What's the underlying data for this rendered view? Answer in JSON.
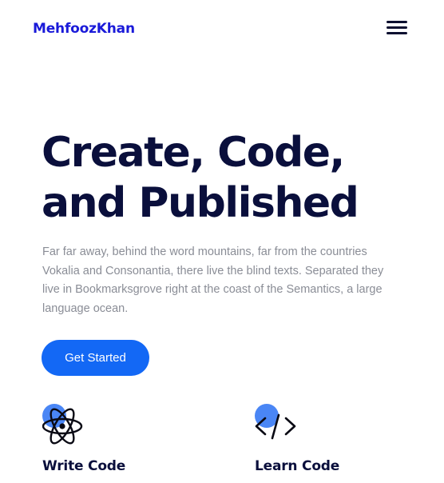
{
  "header": {
    "brand": "MehfoozKhan",
    "menu_icon": "hamburger-menu-icon"
  },
  "hero": {
    "title_line_1": "Create, Code,",
    "title_line_2": "and Published",
    "description": "Far far away, behind the word mountains, far from the countries Vokalia and Consonantia, there live the blind texts. Separated they live in Bookmarksgrove right at the coast of the Semantics, a large language ocean.",
    "cta_label": "Get Started"
  },
  "features": [
    {
      "icon": "atom-icon",
      "title": "Write Code"
    },
    {
      "icon": "code-brackets-icon",
      "title": "Learn Code"
    }
  ],
  "colors": {
    "brand": "#1a1ad9",
    "heading": "#0a0f3c",
    "body_text": "#8a8d96",
    "accent": "#1368f5",
    "icon_dot": "#4a86f5"
  }
}
